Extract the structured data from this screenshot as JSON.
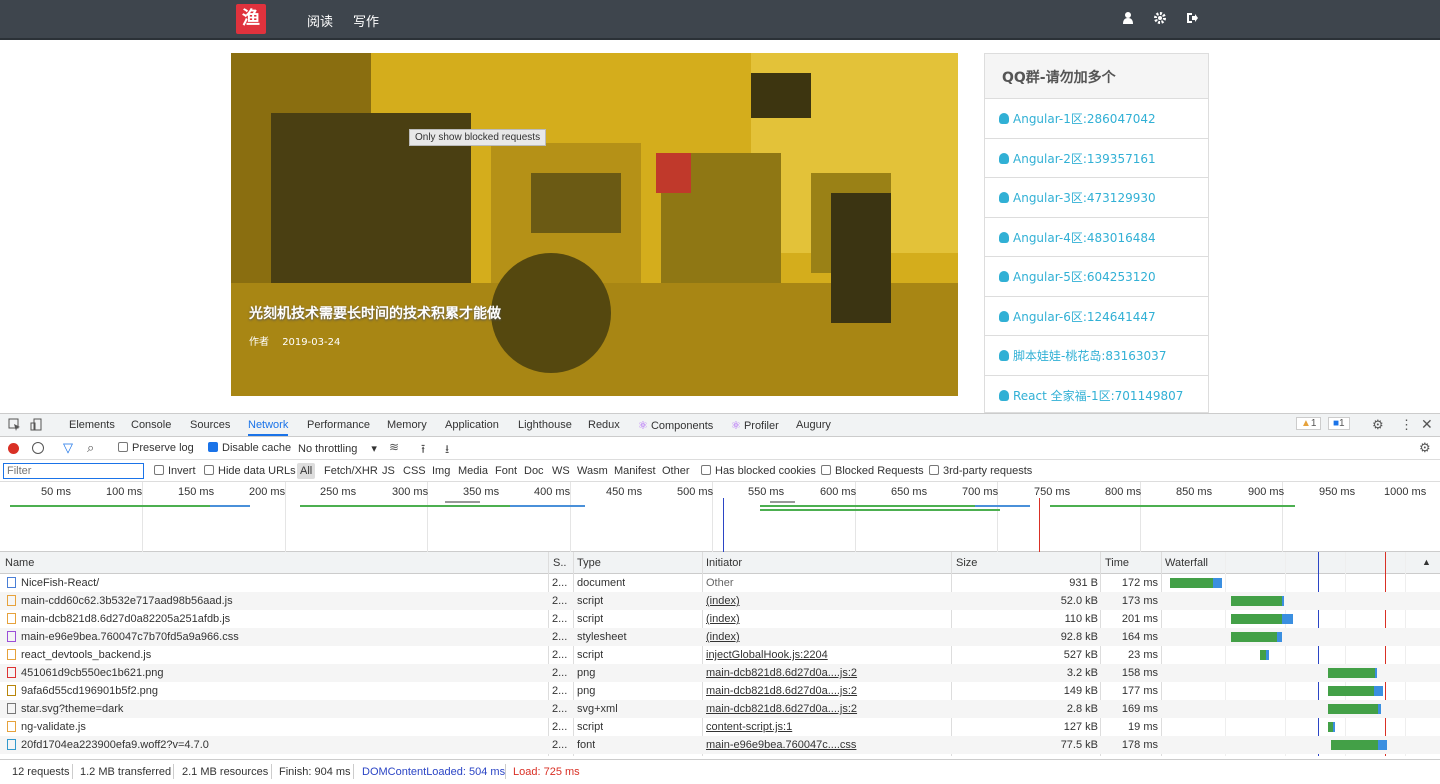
{
  "nav": {
    "logo": "渔",
    "links": [
      "阅读",
      "写作"
    ],
    "icons": [
      "user-icon",
      "gear-icon",
      "sign-out-icon"
    ]
  },
  "hero": {
    "tooltip": "Only show blocked requests",
    "title": "光刻机技术需要长时间的技术积累才能做",
    "author_label": "作者",
    "date": "2019-03-24"
  },
  "panel": {
    "title": "QQ群-请勿加多个",
    "items": [
      "Angular-1区:286047042",
      "Angular-2区:139357161",
      "Angular-3区:473129930",
      "Angular-4区:483016484",
      "Angular-5区:604253120",
      "Angular-6区:124641447",
      "脚本娃娃-桃花岛:83163037",
      "React 全家福-1区:701149807"
    ]
  },
  "devtools": {
    "tabs": [
      "Elements",
      "Console",
      "Sources",
      "Network",
      "Performance",
      "Memory",
      "Application",
      "Lighthouse",
      "Redux",
      "Components",
      "Profiler",
      "Augury"
    ],
    "active_tab": "Network",
    "warnings": "1",
    "messages": "1",
    "toolbar": {
      "preserve_log": "Preserve log",
      "disable_cache": "Disable cache",
      "throttling": "No throttling"
    },
    "filter": {
      "placeholder": "Filter",
      "invert": "Invert",
      "hide_data_urls": "Hide data URLs",
      "types": [
        "All",
        "Fetch/XHR",
        "JS",
        "CSS",
        "Img",
        "Media",
        "Font",
        "Doc",
        "WS",
        "Wasm",
        "Manifest",
        "Other"
      ],
      "has_blocked_cookies": "Has blocked cookies",
      "blocked_requests": "Blocked Requests",
      "third_party": "3rd-party requests"
    },
    "ticks": [
      "50 ms",
      "100 ms",
      "150 ms",
      "200 ms",
      "250 ms",
      "300 ms",
      "350 ms",
      "400 ms",
      "450 ms",
      "500 ms",
      "550 ms",
      "600 ms",
      "650 ms",
      "700 ms",
      "750 ms",
      "800 ms",
      "850 ms",
      "900 ms",
      "950 ms",
      "1000 ms"
    ],
    "columns": [
      "Name",
      "S..",
      "Type",
      "Initiator",
      "Size",
      "Time",
      "Waterfall"
    ],
    "rows": [
      {
        "name": "NiceFish-React/",
        "status": "2...",
        "type": "document",
        "initiator": "Other",
        "size": "931 B",
        "time": "172 ms",
        "icon": "document-icon",
        "color": "#4a7fd6",
        "link": false
      },
      {
        "name": "main-cdd60c62.3b532e717aad98b56aad.js",
        "status": "2...",
        "type": "script",
        "initiator": "(index)",
        "size": "52.0 kB",
        "time": "173 ms",
        "icon": "script-icon",
        "color": "#e6a23c",
        "link": true
      },
      {
        "name": "main-dcb821d8.6d27d0a82205a251afdb.js",
        "status": "2...",
        "type": "script",
        "initiator": "(index)",
        "size": "110 kB",
        "time": "201 ms",
        "icon": "script-icon",
        "color": "#e6a23c",
        "link": true
      },
      {
        "name": "main-e96e9bea.760047c7b70fd5a9a966.css",
        "status": "2...",
        "type": "stylesheet",
        "initiator": "(index)",
        "size": "92.8 kB",
        "time": "164 ms",
        "icon": "stylesheet-icon",
        "color": "#9c4fd8",
        "link": true
      },
      {
        "name": "react_devtools_backend.js",
        "status": "2...",
        "type": "script",
        "initiator": "injectGlobalHook.js:2204",
        "size": "527 kB",
        "time": "23 ms",
        "icon": "script-icon",
        "color": "#e6a23c",
        "link": true
      },
      {
        "name": "451061d9cb550ec1b621.png",
        "status": "2...",
        "type": "png",
        "initiator": "main-dcb821d8.6d27d0a....js:2",
        "size": "3.2 kB",
        "time": "158 ms",
        "icon": "image-icon",
        "color": "#d33",
        "link": true
      },
      {
        "name": "9afa6d55cd196901b5f2.png",
        "status": "2...",
        "type": "png",
        "initiator": "main-dcb821d8.6d27d0a....js:2",
        "size": "149 kB",
        "time": "177 ms",
        "icon": "image-icon",
        "color": "#b8860b",
        "link": true
      },
      {
        "name": "star.svg?theme=dark",
        "status": "2...",
        "type": "svg+xml",
        "initiator": "main-dcb821d8.6d27d0a....js:2",
        "size": "2.8 kB",
        "time": "169 ms",
        "icon": "svg-icon",
        "color": "#777",
        "link": true
      },
      {
        "name": "ng-validate.js",
        "status": "2...",
        "type": "script",
        "initiator": "content-script.js:1",
        "size": "127 kB",
        "time": "19 ms",
        "icon": "script-icon",
        "color": "#e6a23c",
        "link": true
      },
      {
        "name": "20fd1704ea223900efa9.woff2?v=4.7.0",
        "status": "2...",
        "type": "font",
        "initiator": "main-e96e9bea.760047c....css",
        "size": "77.5 kB",
        "time": "178 ms",
        "icon": "font-icon",
        "color": "#39c",
        "link": true
      }
    ],
    "status_bar": {
      "requests": "12 requests",
      "transferred": "1.2 MB transferred",
      "resources": "2.1 MB resources",
      "finish": "Finish: 904 ms",
      "dcl": "DOMContentLoaded: 504 ms",
      "load": "Load: 725 ms"
    }
  }
}
